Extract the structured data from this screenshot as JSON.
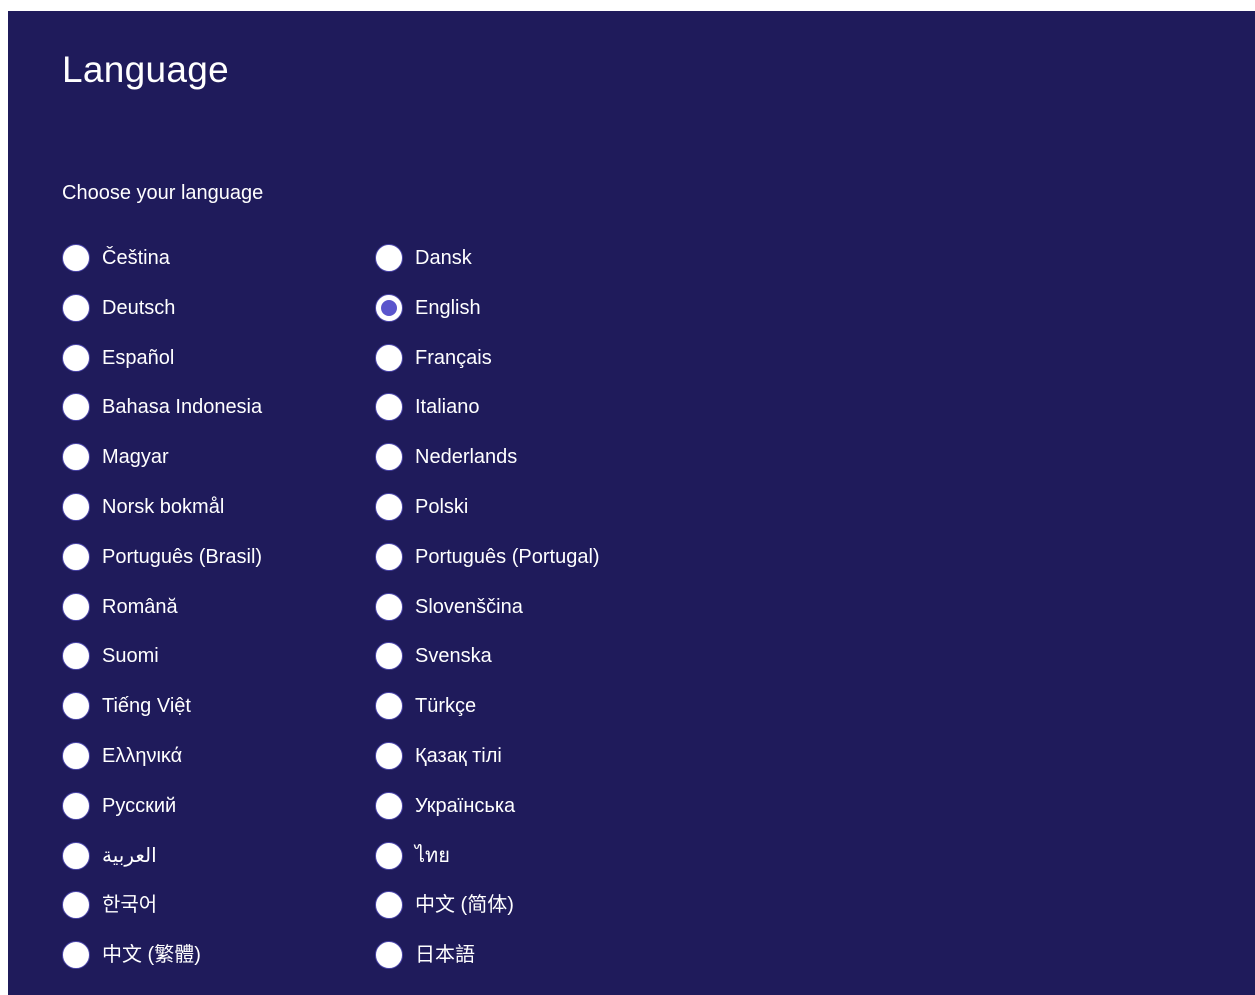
{
  "header": {
    "title": "Language",
    "subtitle": "Choose your language"
  },
  "languages": [
    {
      "label": "Čeština",
      "checked": false
    },
    {
      "label": "Dansk",
      "checked": false
    },
    {
      "label": "Deutsch",
      "checked": false
    },
    {
      "label": "English",
      "checked": true
    },
    {
      "label": "Español",
      "checked": false
    },
    {
      "label": "Français",
      "checked": false
    },
    {
      "label": "Bahasa Indonesia",
      "checked": false
    },
    {
      "label": "Italiano",
      "checked": false
    },
    {
      "label": "Magyar",
      "checked": false
    },
    {
      "label": "Nederlands",
      "checked": false
    },
    {
      "label": "Norsk bokmål",
      "checked": false
    },
    {
      "label": "Polski",
      "checked": false
    },
    {
      "label": "Português (Brasil)",
      "checked": false
    },
    {
      "label": "Português (Portugal)",
      "checked": false
    },
    {
      "label": "Română",
      "checked": false
    },
    {
      "label": "Slovenščina",
      "checked": false
    },
    {
      "label": "Suomi",
      "checked": false
    },
    {
      "label": "Svenska",
      "checked": false
    },
    {
      "label": "Tiếng Việt",
      "checked": false
    },
    {
      "label": "Türkçe",
      "checked": false
    },
    {
      "label": "Ελληνικά",
      "checked": false
    },
    {
      "label": "Қазақ тілі",
      "checked": false
    },
    {
      "label": "Русский",
      "checked": false
    },
    {
      "label": "Українська",
      "checked": false
    },
    {
      "label": "العربية",
      "checked": false
    },
    {
      "label": "ไทย",
      "checked": false
    },
    {
      "label": "한국어",
      "checked": false
    },
    {
      "label": "中文 (简体)",
      "checked": false
    },
    {
      "label": "中文 (繁體)",
      "checked": false
    },
    {
      "label": "日本語",
      "checked": false
    }
  ],
  "colors": {
    "background": "#1f1b5b",
    "text": "#ffffff",
    "radio_fill": "#ffffff",
    "radio_selected": "#5a55cc"
  }
}
